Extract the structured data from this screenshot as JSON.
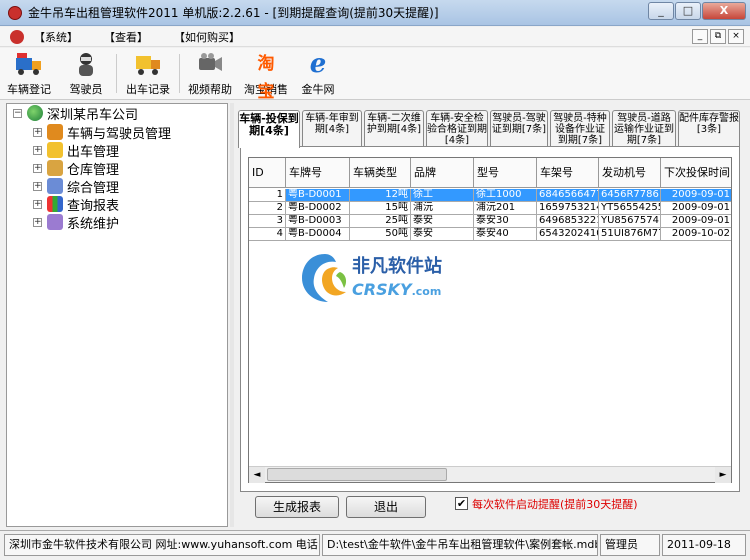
{
  "window": {
    "title": "金牛吊车出租管理软件2011 单机版:2.2.61 - [到期提醒查询(提前30天提醒)]",
    "controls": [
      "_",
      "□",
      "X"
    ]
  },
  "menu": {
    "items": [
      "【系统】",
      "【查看】",
      "【如何购买】"
    ],
    "mdi_controls": [
      "_",
      "⧉",
      "×"
    ]
  },
  "toolbar": {
    "buttons": [
      {
        "label": "车辆登记",
        "icon": "truck-icon"
      },
      {
        "label": "驾驶员",
        "icon": "driver-icon"
      },
      {
        "label": "出车记录",
        "icon": "dispatch-truck-icon"
      },
      {
        "label": "视频帮助",
        "icon": "video-icon"
      },
      {
        "label": "淘宝销售",
        "icon": "taobao-icon",
        "icon_text": "淘宝"
      },
      {
        "label": "金牛网",
        "icon": "ie-icon",
        "icon_text": "e"
      }
    ]
  },
  "tree": {
    "root": "深圳某吊车公司",
    "root_expander": "−",
    "expander": "+",
    "items": [
      "车辆与驾驶员管理",
      "出车管理",
      "仓库管理",
      "综合管理",
      "查询报表",
      "系统维护"
    ]
  },
  "tabs": [
    {
      "label": "车辆-投保到期[4条]",
      "active": true
    },
    {
      "label": "车辆-年审到期[4条]",
      "active": false
    },
    {
      "label": "车辆-二次维护到期[4条]",
      "active": false
    },
    {
      "label": "车辆-安全检验合格证到期[4条]",
      "active": false
    },
    {
      "label": "驾驶员-驾驶证到期[7条]",
      "active": false
    },
    {
      "label": "驾驶员-特种设备作业证到期[7条]",
      "active": false
    },
    {
      "label": "驾驶员-道路运输作业证到期[7条]",
      "active": false
    },
    {
      "label": "配件库存警报[3条]",
      "active": false
    }
  ],
  "grid": {
    "columns": [
      "ID",
      "车牌号",
      "车辆类型",
      "品牌",
      "型号",
      "车架号",
      "发动机号",
      "下次投保时间"
    ],
    "rows": [
      [
        "1",
        "粤B-D0001",
        "12吨",
        "徐工",
        "徐工1000",
        "6846566477",
        "6456R77861",
        "2009-09-01"
      ],
      [
        "2",
        "粤B-D0002",
        "15吨",
        "浦沅",
        "浦沅201",
        "1659753214",
        "YT56554255",
        "2009-09-01"
      ],
      [
        "3",
        "粤B-D0003",
        "25吨",
        "泰安",
        "泰安30",
        "6496853221",
        "YU85675741",
        "2009-09-01"
      ],
      [
        "4",
        "粤B-D0004",
        "50吨",
        "泰安",
        "泰安40",
        "6543202410",
        "51UI876M77",
        "2009-10-02"
      ]
    ],
    "selected_row": 0,
    "scroll_left": "◄",
    "scroll_right": "►"
  },
  "watermark": {
    "title": "非凡软件站",
    "subtitle": "CRSKY",
    "suffix": ".com"
  },
  "actions": {
    "report_button": "生成报表",
    "exit_button": "退出",
    "startup_reminder_label": "每次软件启动提醒(提前30天提醒)",
    "startup_reminder_checked": true,
    "check_mark": "✔"
  },
  "statusbar": {
    "company": "深圳市金牛软件技术有限公司 网址:www.yuhansoft.com 电话",
    "path": "D:\\test\\金牛软件\\金牛吊车出租管理软件\\案例套帐.mdb",
    "user": "管理员",
    "date": "2011-09-18"
  },
  "colors": {
    "selection": "#3399ff",
    "reminder_text": "#dd0000",
    "titlebar": "#a9c4e4"
  }
}
